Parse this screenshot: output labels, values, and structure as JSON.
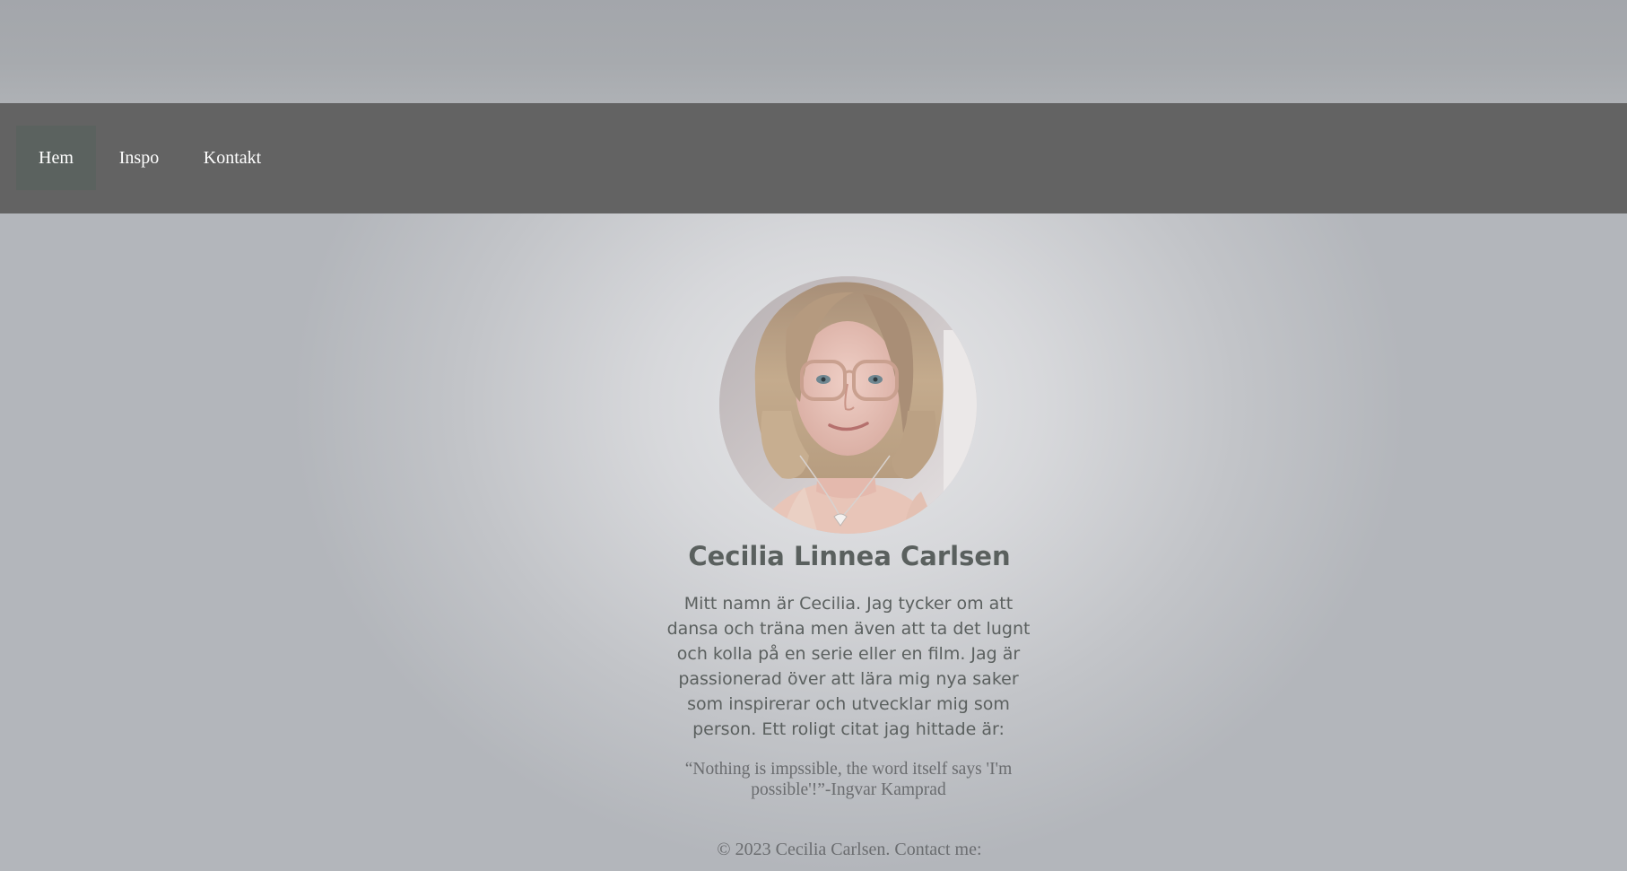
{
  "nav": {
    "items": [
      {
        "label": "Hem",
        "active": true
      },
      {
        "label": "Inspo",
        "active": false
      },
      {
        "label": "Kontakt",
        "active": false
      }
    ]
  },
  "profile": {
    "photo_icon": "profile-photo",
    "name": "Cecilia Linnea Carlsen",
    "bio": "Mitt namn är Cecilia. Jag tycker om att dansa och träna men även att ta det lugnt och kolla på en serie eller en film. Jag är passionerad över att lära mig nya saker som inspirerar och utvecklar mig som person. Ett roligt citat jag hittade är:",
    "quote": "“Nothing is impssible, the word itself says 'I'm possible'!”-Ingvar Kamprad"
  },
  "footer": {
    "text": "© 2023 Cecilia Carlsen. Contact me:"
  },
  "colors": {
    "navbar": "#636363",
    "nav_active": "#5b625f",
    "heading": "#5a605e"
  }
}
